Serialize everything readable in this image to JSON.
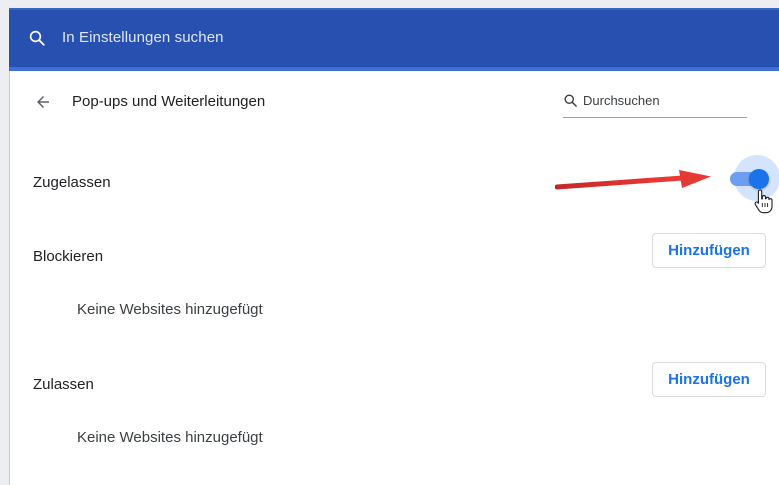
{
  "search": {
    "placeholder": "In Einstellungen suchen",
    "icon": "search-icon"
  },
  "page": {
    "title": "Pop-ups und Weiterleitungen",
    "filter_placeholder": "Durchsuchen"
  },
  "allowed_toggle": {
    "label": "Zugelassen",
    "checked": true
  },
  "sections": {
    "block": {
      "label": "Blockieren",
      "add_label": "Hinzufügen",
      "empty_text": "Keine Websites hinzugefügt"
    },
    "allow": {
      "label": "Zulassen",
      "add_label": "Hinzufügen",
      "empty_text": "Keine Websites hinzugefügt"
    }
  },
  "colors": {
    "header": "#2850b0",
    "accent": "#1a73e8",
    "annotation_arrow": "#e53935"
  }
}
